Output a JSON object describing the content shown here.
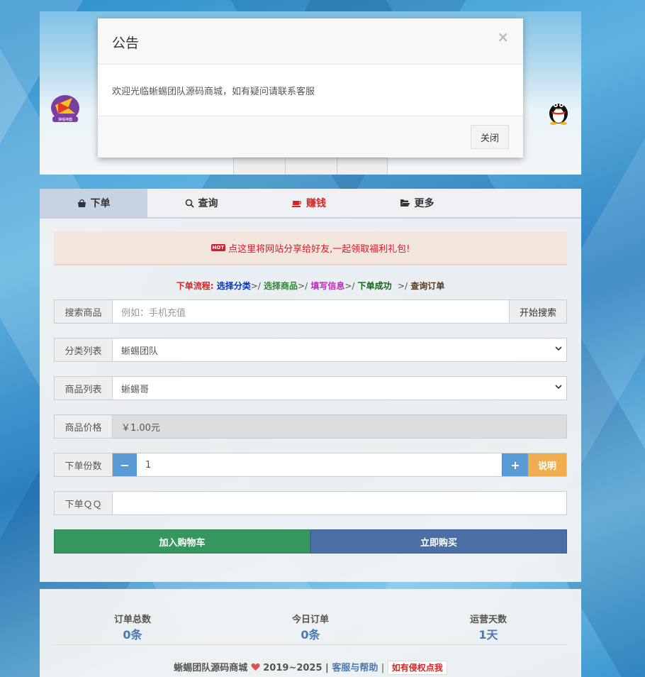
{
  "header": {
    "left_logo_text": "弹唱神器"
  },
  "tabs": [
    {
      "label": "下单",
      "icon": "shopping-bag-icon"
    },
    {
      "label": "查询",
      "icon": "search-icon"
    },
    {
      "label": "赚钱",
      "icon": "coffee-icon"
    },
    {
      "label": "更多",
      "icon": "folder-open-icon"
    }
  ],
  "notice": {
    "badge": "HOT",
    "text": "点这里将网站分享给好友,一起领取福利礼包!"
  },
  "flow": {
    "prefix": "下单流程:",
    "step1": "选择分类",
    "step2": "选择商品",
    "step3": "填写信息",
    "step4": "下单成功",
    "step5": "查询订单",
    "sep": ">/"
  },
  "form": {
    "search_label": "搜索商品",
    "search_placeholder": "例如：手机充值",
    "search_button": "开始搜索",
    "category_label": "分类列表",
    "category_value": "蜥蜴团队",
    "product_label": "商品列表",
    "product_value": "蜥蜴哥",
    "price_label": "商品价格",
    "price_value": "￥1.00元",
    "quantity_label": "下单份数",
    "quantity_minus": "−",
    "quantity_value": "1",
    "quantity_plus": "+",
    "explain_button": "说明",
    "qq_label": "下单ＱＱ",
    "qq_value": "",
    "cart_button": "加入购物车",
    "buy_button": "立即购买"
  },
  "stats": [
    {
      "title": "订单总数",
      "value": "0条"
    },
    {
      "title": "今日订单",
      "value": "0条"
    },
    {
      "title": "运营天数",
      "value": "1天"
    }
  ],
  "footer": {
    "site": "蜥蜴团队源码商城",
    "years": "2019~2025 |",
    "help": "客服与帮助",
    "sep": "|",
    "report": "如有侵权点我"
  },
  "modal": {
    "title": "公告",
    "close_x": "×",
    "body": "欢迎光临蜥蜴团队源码商城，如有疑问请联系客服",
    "close_button": "关闭"
  },
  "colors": {
    "red": "#e0162b",
    "blue_link": "#4a78b4",
    "cart_green": "#36975e",
    "buy_blue": "#4a6fa5",
    "explain_orange": "#f0ad4e"
  }
}
